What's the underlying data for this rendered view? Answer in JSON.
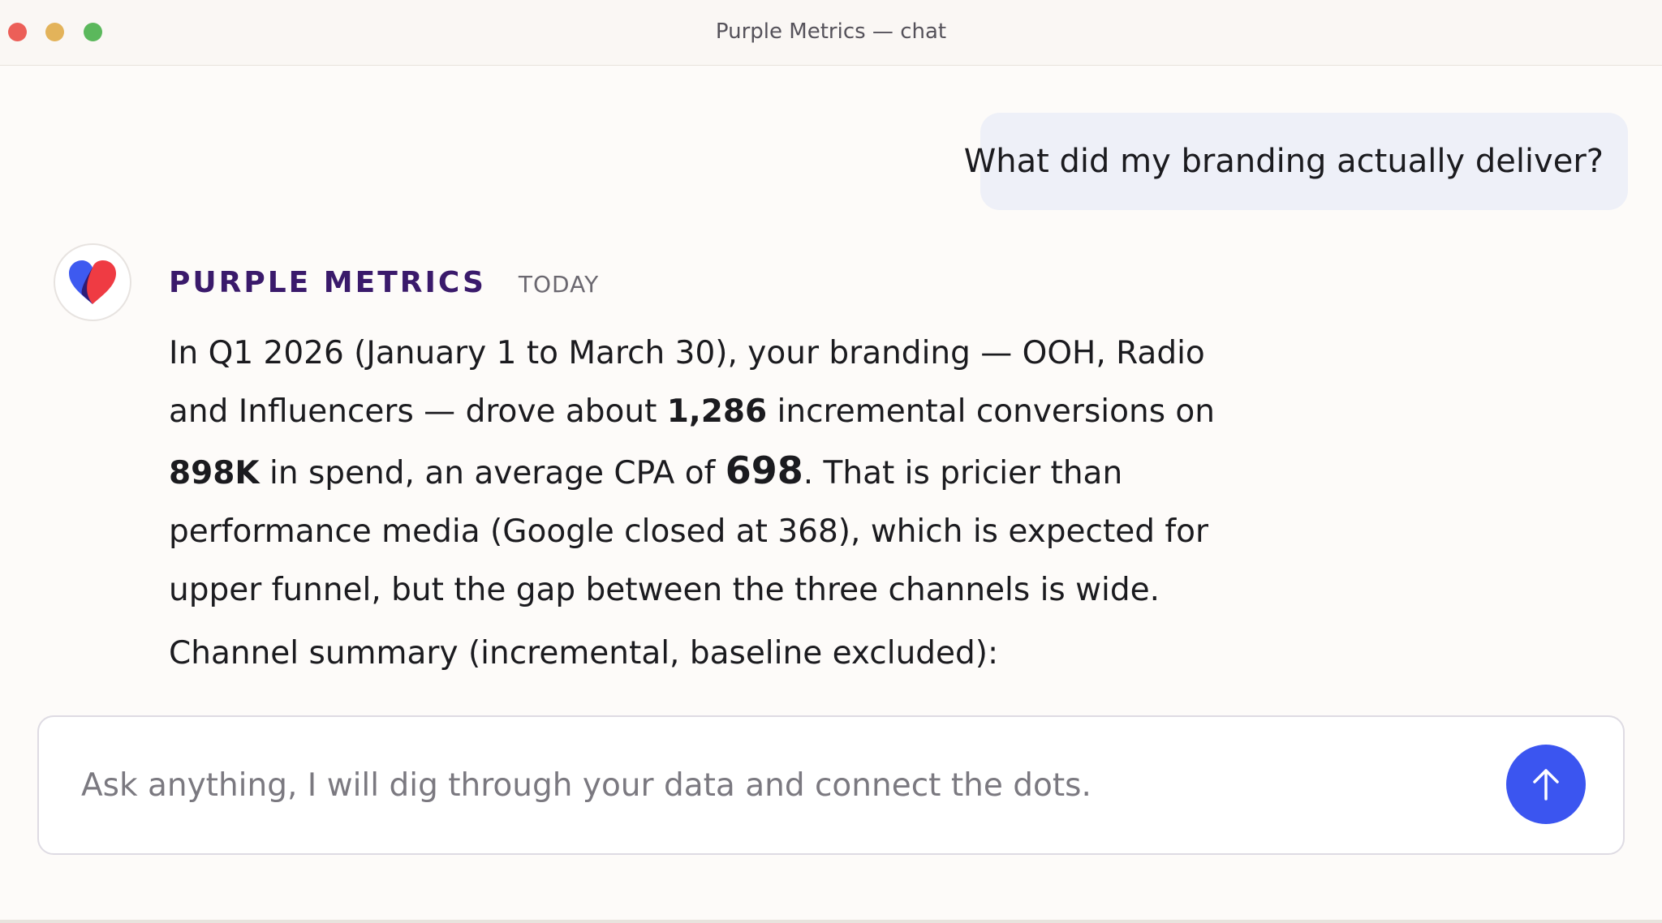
{
  "window": {
    "title": "Purple Metrics — chat"
  },
  "user_message": {
    "text": "What did my branding actually deliver?"
  },
  "assistant_message": {
    "sender": "PURPLE METRICS",
    "time": "TODAY",
    "paragraph": {
      "p1": "In Q1 2026 (January 1 to March 30), your branding — OOH, Radio and Influencers — drove about ",
      "conversions": "1,286",
      "p2": " incremental conversions on ",
      "spend": "898K",
      "p3": " in spend, an average CPA of ",
      "cpa": "698",
      "p4": ". That is pricier than performance media (Google closed at 368), which is expected for upper funnel, but the gap between the three channels is wide."
    },
    "summary": "Channel summary (incremental, baseline excluded):"
  },
  "composer": {
    "placeholder": "Ask anything, I will dig through your data and connect the dots.",
    "value": ""
  },
  "icons": {
    "logo": "heart-logo-icon",
    "send": "arrow-up-icon"
  },
  "colors": {
    "brand_text": "#3a1a6b",
    "send_button": "#3b55f0",
    "user_bubble": "#eef0f8",
    "logo_blue": "#3e5af0",
    "logo_red": "#ef3b43"
  }
}
